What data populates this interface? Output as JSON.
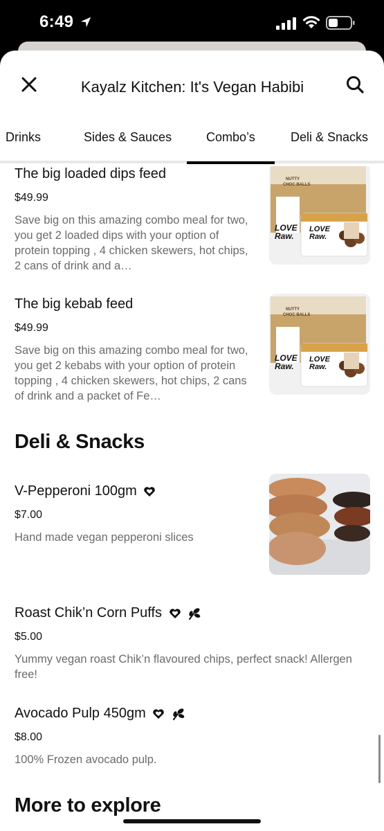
{
  "status_bar": {
    "time": "6:49"
  },
  "header": {
    "title": "Kayalz Kitchen: It's Vegan Habibi"
  },
  "tabs": [
    {
      "label": "Drinks"
    },
    {
      "label": "Sides & Sauces"
    },
    {
      "label": "Combo’s",
      "active": true
    },
    {
      "label": "Deli & Snacks"
    }
  ],
  "combos": [
    {
      "name": "The big loaded dips feed",
      "price": "$49.99",
      "description": "Save big on this amazing combo meal for two, you get 2 loaded dips with your option of protein topping , 4 chicken skewers, hot chips, 2 cans of drink and a…",
      "image_text": {
        "brand": "LOVE Raw.",
        "line1": "NUTTY",
        "line2": "CHOC BALLS"
      }
    },
    {
      "name": "The big kebab feed",
      "price": "$49.99",
      "description": "Save big on this amazing combo meal for two, you get 2 kebabs with your option of protein topping , 4 chicken skewers, hot chips, 2 cans of drink and a packet of Fe…",
      "image_text": {
        "brand": "LOVE Raw.",
        "line1": "NUTTY",
        "line2": "CHOC BALLS"
      }
    }
  ],
  "sections": {
    "deli": "Deli & Snacks",
    "more": "More to explore"
  },
  "deli_items": [
    {
      "name": "V-Pepperoni 100gm",
      "price": "$7.00",
      "description": "Hand made vegan pepperoni slices",
      "icons": [
        "heart-icon"
      ]
    },
    {
      "name": "Roast Chik’n Corn Puffs",
      "price": "$5.00",
      "description": "Yummy vegan roast Chik’n flavoured chips, perfect snack! Allergen free!",
      "icons": [
        "heart-icon",
        "leaf-icon"
      ]
    },
    {
      "name": "Avocado Pulp 450gm",
      "price": "$8.00",
      "description": "100% Frozen avocado pulp.",
      "icons": [
        "heart-icon",
        "leaf-icon"
      ]
    }
  ],
  "colors": {
    "accent": "#000000",
    "muted_text": "#6b6b6b",
    "divider": "#e8e8e8"
  }
}
